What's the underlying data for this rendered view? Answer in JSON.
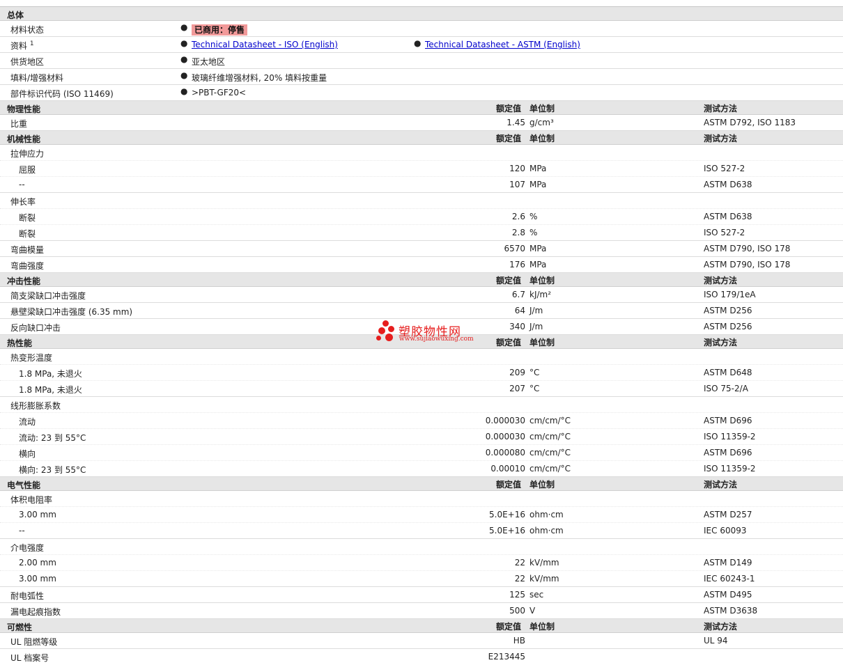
{
  "general": {
    "title": "总体",
    "status_label": "材料状态",
    "status_value": "已商用：停售",
    "docs_label": "资料",
    "docs_sup": "1",
    "doc_iso": "Technical Datasheet - ISO (English)",
    "doc_astm": "Technical Datasheet - ASTM (English)",
    "region_label": "供货地区",
    "region_value": "亚太地区",
    "filler_label": "填料/增强材料",
    "filler_value": "玻璃纤维增强材料, 20% 填料按重量",
    "part_label": "部件标识代码 (ISO 11469)",
    "part_value": ">PBT-GF20<"
  },
  "headers": {
    "value": "额定值",
    "unit": "单位制",
    "method": "测试方法"
  },
  "physical": {
    "title": "物理性能",
    "sg": {
      "label": "比重",
      "value": "1.45",
      "unit": "g/cm³",
      "method": "ASTM D792, ISO 1183"
    }
  },
  "mechanical": {
    "title": "机械性能",
    "tensile_label": "拉伸应力",
    "tensile_yield": {
      "label": "屈服",
      "value": "120",
      "unit": "MPa",
      "method": "ISO 527-2"
    },
    "tensile_dash": {
      "label": "--",
      "value": "107",
      "unit": "MPa",
      "method": "ASTM D638"
    },
    "elong_label": "伸长率",
    "elong_1": {
      "label": "断裂",
      "value": "2.6",
      "unit": "%",
      "method": "ASTM D638"
    },
    "elong_2": {
      "label": "断裂",
      "value": "2.8",
      "unit": "%",
      "method": "ISO 527-2"
    },
    "flex_mod": {
      "label": "弯曲模量",
      "value": "6570",
      "unit": "MPa",
      "method": "ASTM D790, ISO 178"
    },
    "flex_str": {
      "label": "弯曲强度",
      "value": "176",
      "unit": "MPa",
      "method": "ASTM D790, ISO 178"
    }
  },
  "impact": {
    "title": "冲击性能",
    "charpy": {
      "label": "简支梁缺口冲击强度",
      "value": "6.7",
      "unit": "kJ/m²",
      "method": "ISO 179/1eA"
    },
    "izod": {
      "label": "悬壁梁缺口冲击强度 (6.35 mm)",
      "value": "64",
      "unit": "J/m",
      "method": "ASTM D256"
    },
    "reverse": {
      "label": "反向缺口冲击",
      "value": "340",
      "unit": "J/m",
      "method": "ASTM D256"
    }
  },
  "thermal": {
    "title": "热性能",
    "hdt_label": "热变形温度",
    "hdt_1": {
      "label": "1.8 MPa, 未退火",
      "value": "209",
      "unit": "°C",
      "method": "ASTM D648"
    },
    "hdt_2": {
      "label": "1.8 MPa, 未退火",
      "value": "207",
      "unit": "°C",
      "method": "ISO 75-2/A"
    },
    "clte_label": "线形膨胀系数",
    "clte_1": {
      "label": "流动",
      "value": "0.000030",
      "unit": "cm/cm/°C",
      "method": "ASTM D696"
    },
    "clte_2": {
      "label": "流动: 23 到  55°C",
      "value": "0.000030",
      "unit": "cm/cm/°C",
      "method": "ISO 11359-2"
    },
    "clte_3": {
      "label": "横向",
      "value": "0.000080",
      "unit": "cm/cm/°C",
      "method": "ASTM D696"
    },
    "clte_4": {
      "label": "横向: 23 到  55°C",
      "value": "0.00010",
      "unit": "cm/cm/°C",
      "method": "ISO 11359-2"
    }
  },
  "electrical": {
    "title": "电气性能",
    "vr_label": "体积电阻率",
    "vr_1": {
      "label": "3.00 mm",
      "value": "5.0E+16",
      "unit": "ohm·cm",
      "method": "ASTM D257"
    },
    "vr_2": {
      "label": "--",
      "value": "5.0E+16",
      "unit": "ohm·cm",
      "method": "IEC 60093"
    },
    "ds_label": "介电强度",
    "ds_1": {
      "label": "2.00 mm",
      "value": "22",
      "unit": "kV/mm",
      "method": "ASTM D149"
    },
    "ds_2": {
      "label": "3.00 mm",
      "value": "22",
      "unit": "kV/mm",
      "method": "IEC 60243-1"
    },
    "arc": {
      "label": "耐电弧性",
      "value": "125",
      "unit": "sec",
      "method": "ASTM D495"
    },
    "cti": {
      "label": "漏电起痕指数",
      "value": "500",
      "unit": "V",
      "method": "ASTM D3638"
    }
  },
  "flammability": {
    "title": "可燃性",
    "ul": {
      "label": "UL 阻燃等级",
      "value": "HB",
      "unit": "",
      "method": "UL 94"
    },
    "file": {
      "label": "UL 档案号",
      "value": "E213445",
      "unit": "",
      "method": ""
    }
  },
  "watermark": {
    "name": "塑胶物性网",
    "url": "www.sujiaowuxing.com",
    "color": "#e61e1e"
  }
}
